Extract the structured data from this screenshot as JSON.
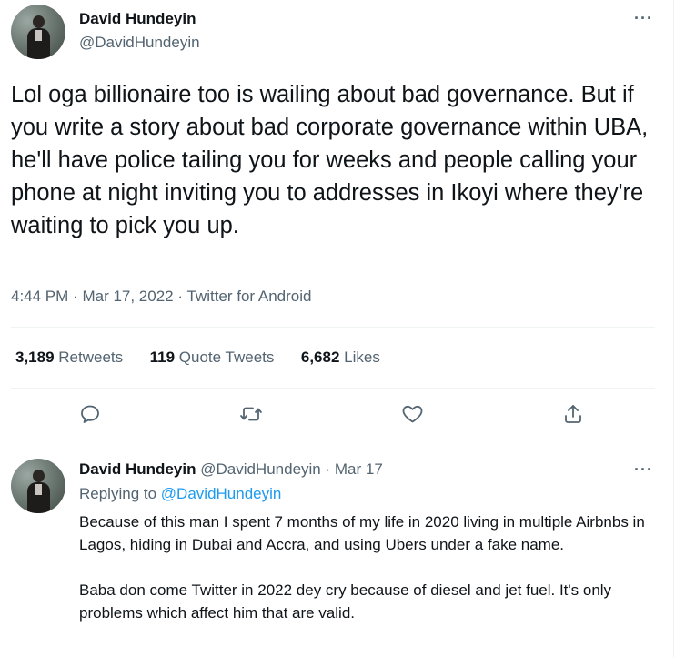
{
  "tweet": {
    "author_name": "David Hundeyin",
    "author_handle": "@DavidHundeyin",
    "more_icon": "more-horizontal-icon",
    "text": "Lol oga billionaire too is wailing about bad governance. But if you write a story about bad corporate governance within UBA, he'll have police tailing you for weeks and people calling your phone at night inviting you to addresses in Ikoyi where they're waiting to pick you up.",
    "time": "4:44 PM",
    "date": "Mar 17, 2022",
    "source": "Twitter for Android",
    "meta_separator": "·"
  },
  "stats": {
    "retweets_count": "3,189",
    "retweets_label": "Retweets",
    "quotes_count": "119",
    "quotes_label": "Quote Tweets",
    "likes_count": "6,682",
    "likes_label": "Likes"
  },
  "actions": [
    {
      "name": "reply",
      "icon": "reply-icon"
    },
    {
      "name": "retweet",
      "icon": "retweet-icon"
    },
    {
      "name": "like",
      "icon": "heart-icon"
    },
    {
      "name": "share",
      "icon": "share-icon"
    }
  ],
  "reply": {
    "author_name": "David Hundeyin",
    "author_handle": "@DavidHundeyin",
    "separator": "·",
    "date": "Mar 17",
    "replying_prefix": "Replying to",
    "replying_to": "@DavidHundeyin",
    "paragraphs": [
      "Because of this man I spent 7 months of my life in 2020 living in multiple Airbnbs in Lagos, hiding in Dubai and Accra, and using Ubers under a fake name.",
      "Baba don come Twitter in 2022 dey cry because of diesel and jet fuel. It's only problems which affect him that are valid."
    ]
  },
  "colors": {
    "text_primary": "#0f1419",
    "text_secondary": "#536471",
    "accent": "#1d9bf0",
    "divider": "#eff3f4"
  }
}
